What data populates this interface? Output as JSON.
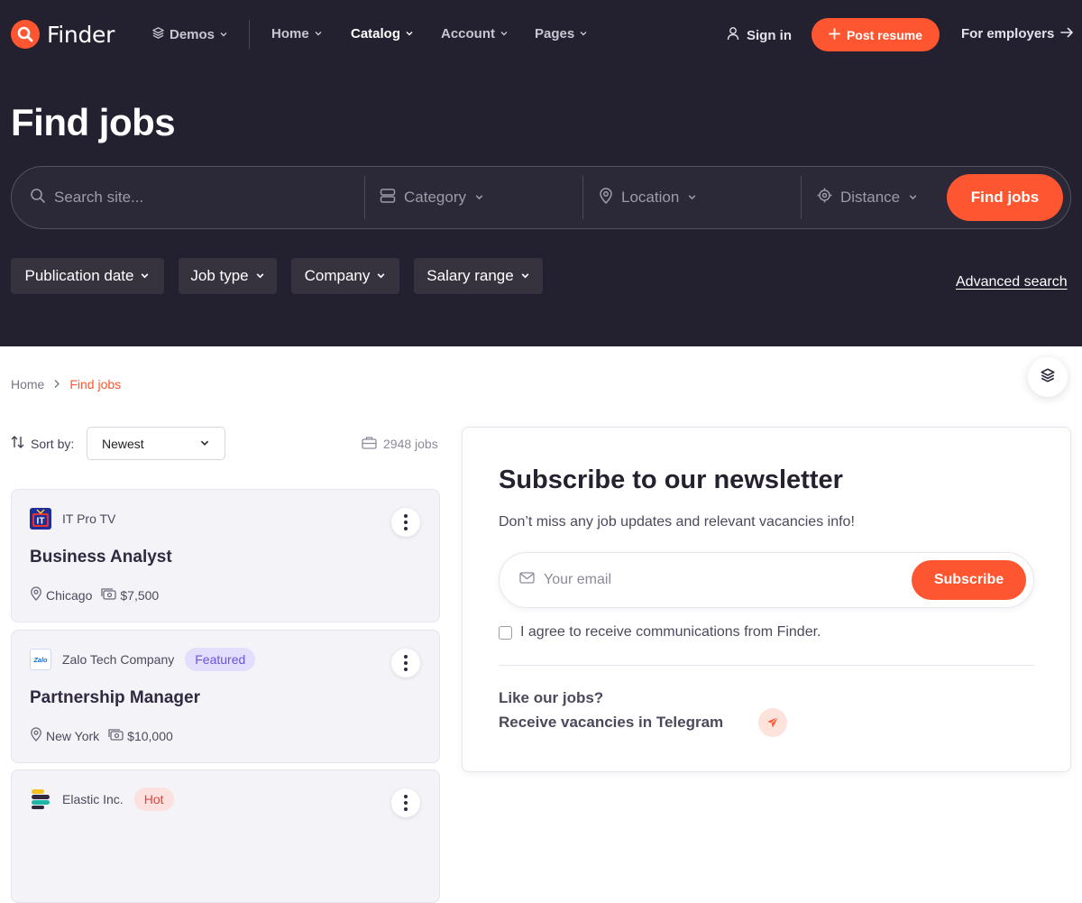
{
  "nav": {
    "brand": "Finder",
    "demos": "Demos",
    "home": "Home",
    "catalog": "Catalog",
    "account": "Account",
    "pages": "Pages",
    "sign_in": "Sign in",
    "post_resume": "Post resume",
    "for_employers": "For employers"
  },
  "hero": {
    "title": "Find jobs",
    "search_placeholder": "Search site...",
    "category": "Category",
    "location": "Location",
    "distance": "Distance",
    "find_button": "Find jobs",
    "filters": [
      "Publication date",
      "Job type",
      "Company",
      "Salary range"
    ],
    "advanced_search": "Advanced search"
  },
  "breadcrumb": {
    "home": "Home",
    "current": "Find jobs"
  },
  "sort": {
    "label": "Sort by:",
    "selected": "Newest",
    "count": "2948 jobs"
  },
  "jobs": [
    {
      "company": "IT Pro TV",
      "logo_text": "IT",
      "badge": "",
      "title": "Business Analyst",
      "location": "Chicago",
      "salary": "$7,500"
    },
    {
      "company": "Zalo Tech Company",
      "logo_text": "Zalo",
      "badge": "Featured",
      "title": "Partnership Manager",
      "location": "New York",
      "salary": "$10,000"
    },
    {
      "company": "Elastic Inc.",
      "logo_text": "",
      "badge": "Hot",
      "title": "",
      "location": "",
      "salary": ""
    }
  ],
  "newsletter": {
    "title": "Subscribe to our newsletter",
    "subtitle": "Don’t miss any job updates and relevant vacancies info!",
    "email_placeholder": "Your email",
    "subscribe": "Subscribe",
    "agree": "I agree to receive communications from Finder.",
    "telegram_line1": "Like our jobs?",
    "telegram_line2": "Receive vacancies in Telegram"
  },
  "colors": {
    "accent": "#fd5631",
    "hero_bg": "#23202f",
    "featured": "#6a55d6",
    "hot": "#e2433a"
  },
  "icons": [
    "search-icon",
    "layers-icon",
    "chevron-down-icon",
    "user-icon",
    "plus-icon",
    "arrow-right-icon",
    "category-icon",
    "map-pin-icon",
    "target-icon",
    "sort-icon",
    "briefcase-icon",
    "cash-icon",
    "more-vertical-icon",
    "mail-icon",
    "telegram-icon"
  ]
}
